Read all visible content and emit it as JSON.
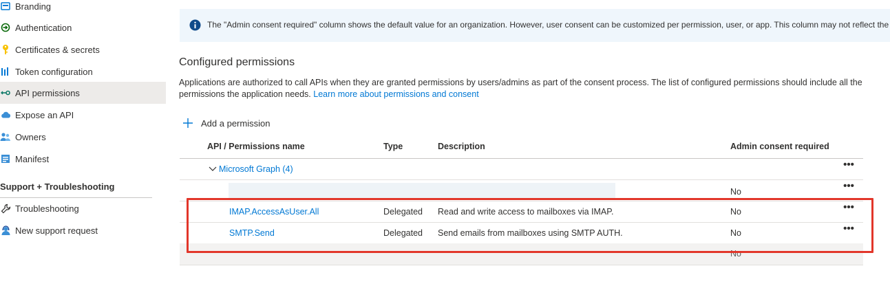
{
  "sidebar": {
    "items": [
      {
        "label": "Branding",
        "icon": "branding-icon"
      },
      {
        "label": "Authentication",
        "icon": "authentication-icon"
      },
      {
        "label": "Certificates & secrets",
        "icon": "key-icon"
      },
      {
        "label": "Token configuration",
        "icon": "token-bars-icon"
      },
      {
        "label": "API permissions",
        "icon": "api-permissions-icon",
        "selected": true
      },
      {
        "label": "Expose an API",
        "icon": "cloud-icon"
      },
      {
        "label": "Owners",
        "icon": "owners-icon"
      },
      {
        "label": "Manifest",
        "icon": "manifest-icon"
      }
    ],
    "section_title": "Support + Troubleshooting",
    "support_items": [
      {
        "label": "Troubleshooting",
        "icon": "wrench-icon"
      },
      {
        "label": "New support request",
        "icon": "support-person-icon"
      }
    ]
  },
  "banner": {
    "icon": "info-icon",
    "text": "The \"Admin consent required\" column shows the default value for an organization. However, user consent can be customized per permission, user, or app. This column may not reflect the va"
  },
  "main": {
    "title": "Configured permissions",
    "description": "Applications are authorized to call APIs when they are granted permissions by users/admins as part of the consent process. The list of configured permissions should include all the permissions the application needs.",
    "learn_more": "Learn more about permissions and consent",
    "add_permission": "Add a permission"
  },
  "table": {
    "headers": {
      "name": "API / Permissions name",
      "type": "Type",
      "description": "Description",
      "admin": "Admin consent required"
    },
    "group": {
      "label": "Microsoft Graph (4)"
    },
    "rows": [
      {
        "name": "",
        "type": "",
        "description": "",
        "admin": "No",
        "redacted": true
      },
      {
        "name": "IMAP.AccessAsUser.All",
        "type": "Delegated",
        "description": "Read and write access to mailboxes via IMAP.",
        "admin": "No"
      },
      {
        "name": "SMTP.Send",
        "type": "Delegated",
        "description": "Send emails from mailboxes using SMTP AUTH.",
        "admin": "No"
      }
    ],
    "partial_row_admin": "No",
    "more_label": "•••"
  },
  "colors": {
    "accent": "#0078d4",
    "highlight": "#e2362a",
    "banner_bg": "#eff6fc",
    "selected_bg": "#edebe9"
  }
}
